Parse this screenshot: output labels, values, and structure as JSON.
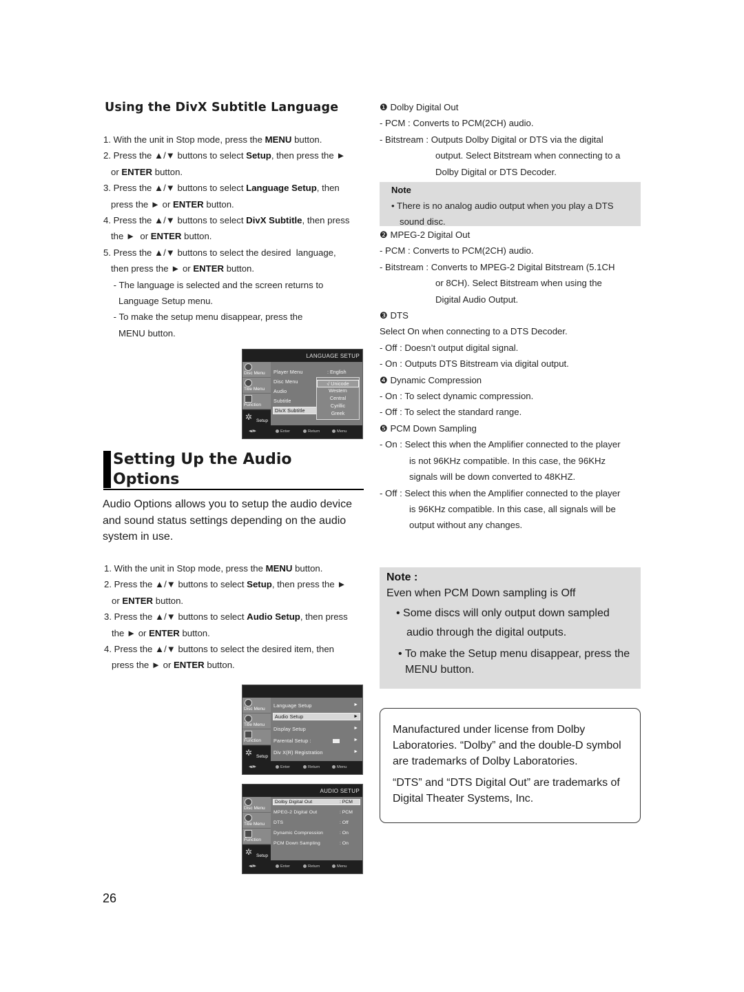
{
  "subtitle_section": {
    "heading": "Using the DivX Subtitle Language",
    "steps": [
      {
        "parts": [
          [
            "1. With the unit in Stop mode, press the ",
            false
          ],
          [
            "MENU",
            true
          ],
          [
            " button.",
            false
          ]
        ]
      },
      {
        "parts": [
          [
            "2. Press the ▲/▼ buttons to select ",
            false
          ],
          [
            "Setup",
            true
          ],
          [
            ", then press the ►",
            false
          ]
        ]
      },
      {
        "parts": [
          [
            "   or ",
            false
          ],
          [
            "ENTER",
            true
          ],
          [
            " button.",
            false
          ]
        ]
      },
      {
        "parts": [
          [
            "3. Press the ▲/▼ buttons to select ",
            false
          ],
          [
            "Language Setup",
            true
          ],
          [
            ", then",
            false
          ]
        ]
      },
      {
        "parts": [
          [
            "   press the ► or ",
            false
          ],
          [
            "ENTER",
            true
          ],
          [
            " button.",
            false
          ]
        ]
      },
      {
        "parts": [
          [
            "4. Press the ▲/▼ buttons to select ",
            false
          ],
          [
            "DivX Subtitle",
            true
          ],
          [
            ", then press",
            false
          ]
        ]
      },
      {
        "parts": [
          [
            "   the ►  or ",
            false
          ],
          [
            "ENTER",
            true
          ],
          [
            " button.",
            false
          ]
        ]
      },
      {
        "parts": [
          [
            "5. Press the ▲/▼ buttons to select the desired  language,",
            false
          ]
        ]
      },
      {
        "parts": [
          [
            "   then press the ► or ",
            false
          ],
          [
            "ENTER",
            true
          ],
          [
            " button.",
            false
          ]
        ]
      },
      {
        "parts": [
          [
            "    - The language is selected and the screen returns to",
            false
          ]
        ]
      },
      {
        "parts": [
          [
            "      Language Setup menu.",
            false
          ]
        ]
      },
      {
        "parts": [
          [
            "    - To make the setup menu disappear, press the",
            false
          ]
        ]
      },
      {
        "parts": [
          [
            "      MENU button.",
            false
          ]
        ]
      }
    ]
  },
  "osd_language": {
    "title": "LANGUAGE SETUP",
    "side_tabs": [
      "Disc Menu",
      "Title Menu",
      "Function",
      "Setup"
    ],
    "rows": [
      "Player Menu",
      "Disc Menu",
      "Audio",
      "Subtitle",
      "DivX Subtitle"
    ],
    "player_menu_value": ": English",
    "popup_options": [
      "√ Unicode",
      "Western",
      "Central",
      "Cyrillic",
      "Greek"
    ],
    "footer": {
      "enter": "Enter",
      "return": "Return",
      "menu": "Menu"
    }
  },
  "audio_section": {
    "heading_line1": "Setting Up the Audio",
    "heading_line2": "Options",
    "intro": "Audio Options allows you to setup the audio device and sound status settings depending on the audio system in use.",
    "steps": [
      {
        "parts": [
          [
            "1. With the unit in Stop mode, press the ",
            false
          ],
          [
            "MENU",
            true
          ],
          [
            " button.",
            false
          ]
        ]
      },
      {
        "parts": [
          [
            "2. Press the ▲/▼ buttons to select ",
            false
          ],
          [
            "Setup",
            true
          ],
          [
            ", then press the ►",
            false
          ]
        ]
      },
      {
        "parts": [
          [
            "   or ",
            false
          ],
          [
            "ENTER",
            true
          ],
          [
            " button.",
            false
          ]
        ]
      },
      {
        "parts": [
          [
            "3. Press the ▲/▼ buttons to select ",
            false
          ],
          [
            "Audio Setup",
            true
          ],
          [
            ", then press",
            false
          ]
        ]
      },
      {
        "parts": [
          [
            "   the ► or ",
            false
          ],
          [
            "ENTER",
            true
          ],
          [
            " button.",
            false
          ]
        ]
      },
      {
        "parts": [
          [
            "4. Press the ▲/▼ buttons to select the desired item, then",
            false
          ]
        ]
      },
      {
        "parts": [
          [
            "   press the ► or ",
            false
          ],
          [
            "ENTER",
            true
          ],
          [
            " button.",
            false
          ]
        ]
      }
    ]
  },
  "osd_setup": {
    "title": "",
    "side_tabs": [
      "Disc Menu",
      "Title Menu",
      "Function",
      "Setup"
    ],
    "rows": [
      "Language Setup",
      "Audio Setup",
      "Display Setup",
      "Parental Setup :",
      "Div X(R) Registration"
    ],
    "footer": {
      "enter": "Enter",
      "return": "Return",
      "menu": "Menu"
    }
  },
  "osd_audio": {
    "title": "AUDIO SETUP",
    "side_tabs": [
      "Disc Menu",
      "Title Menu",
      "Function",
      "Setup"
    ],
    "rows": [
      {
        "label": "Dolby Digital Out",
        "value": ": PCM"
      },
      {
        "label": "MPEG-2 Digital Out",
        "value": ":  PCM"
      },
      {
        "label": "DTS",
        "value": ": Off"
      },
      {
        "label": "Dynamic Compression",
        "value": ": On"
      },
      {
        "label": "PCM Down Sampling",
        "value": ": On"
      }
    ],
    "footer": {
      "enter": "Enter",
      "return": "Return",
      "menu": "Menu"
    }
  },
  "options": {
    "lines": [
      "❶ Dolby Digital Out",
      "- PCM : Converts to PCM(2CH) audio.",
      "- Bitstream : Outputs Dolby Digital or DTS via the digital",
      "output. Select Bitstream when connecting to a",
      "Dolby Digital or DTS Decoder."
    ],
    "note1_title": "Note",
    "note1_body_1": "• There is no analog audio output when you play a DTS",
    "note1_body_2": "sound disc.",
    "lines2": [
      "❷ MPEG-2 Digital Out",
      "- PCM : Converts to PCM(2CH) audio.",
      "- Bitstream : Converts to MPEG-2 Digital Bitstream (5.1CH",
      "or 8CH). Select Bitstream when using the",
      "Digital Audio Output.",
      "❸ DTS",
      "Select On when connecting to a DTS Decoder.",
      "- Off : Doesn’t output digital signal.",
      "- On : Outputs DTS Bitstream via digital output.",
      "❹ Dynamic Compression",
      "- On : To select dynamic compression.",
      "- Off : To select the standard range.",
      "❺ PCM Down Sampling",
      "- On : Select this when the Amplifier connected to the player",
      "is not 96KHz compatible. In this case, the 96KHz",
      "signals will be down converted to 48KHZ.",
      "- Off : Select this when the Amplifier connected to the player",
      "is 96KHz compatible. In this case, all signals will be",
      "output without any changes."
    ]
  },
  "note2": {
    "title": "Note :",
    "line1": "Even when PCM Down sampling is Off",
    "line2": "• Some discs will only output down sampled",
    "line3": "audio through the digital outputs.",
    "line4": "• To make the Setup menu disappear, press the",
    "line5": "MENU button."
  },
  "trademark": {
    "l1": "Manufactured under license from Dolby",
    "l2": "Laboratories. “Dolby” and the double-D symbol",
    "l3": "are trademarks of Dolby Laboratories.",
    "l4": "“DTS” and “DTS Digital Out” are trademarks of",
    "l5": "Digital Theater Systems, Inc."
  },
  "page_number": "26"
}
